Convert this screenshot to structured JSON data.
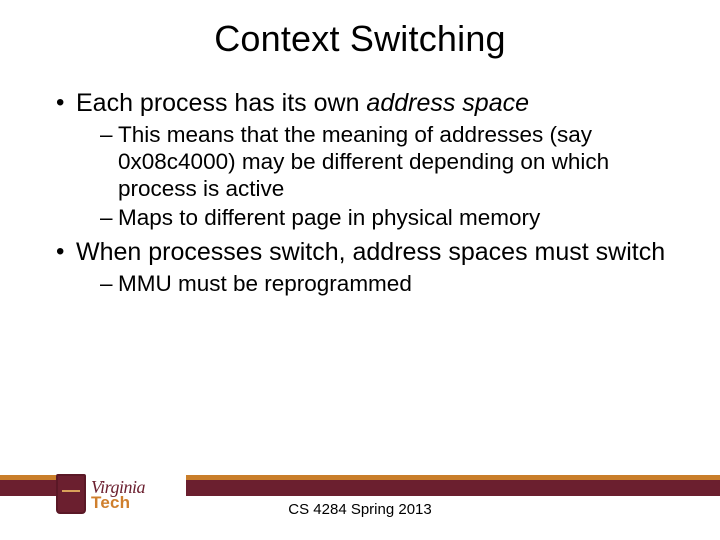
{
  "title": "Context Switching",
  "bullets": {
    "b1_pre": "Each process has its own ",
    "b1_em": "address space",
    "b1_sub1": "This means that the meaning of addresses (say 0x08c4000) may be different depending on which process is active",
    "b1_sub2": "Maps to different page in physical memory",
    "b2": "When processes switch, address spaces must switch",
    "b2_sub1": "MMU must be reprogrammed"
  },
  "footer": {
    "course": "CS 4284 Spring 2013",
    "logo_line1": "Virginia",
    "logo_line2": "Tech"
  }
}
